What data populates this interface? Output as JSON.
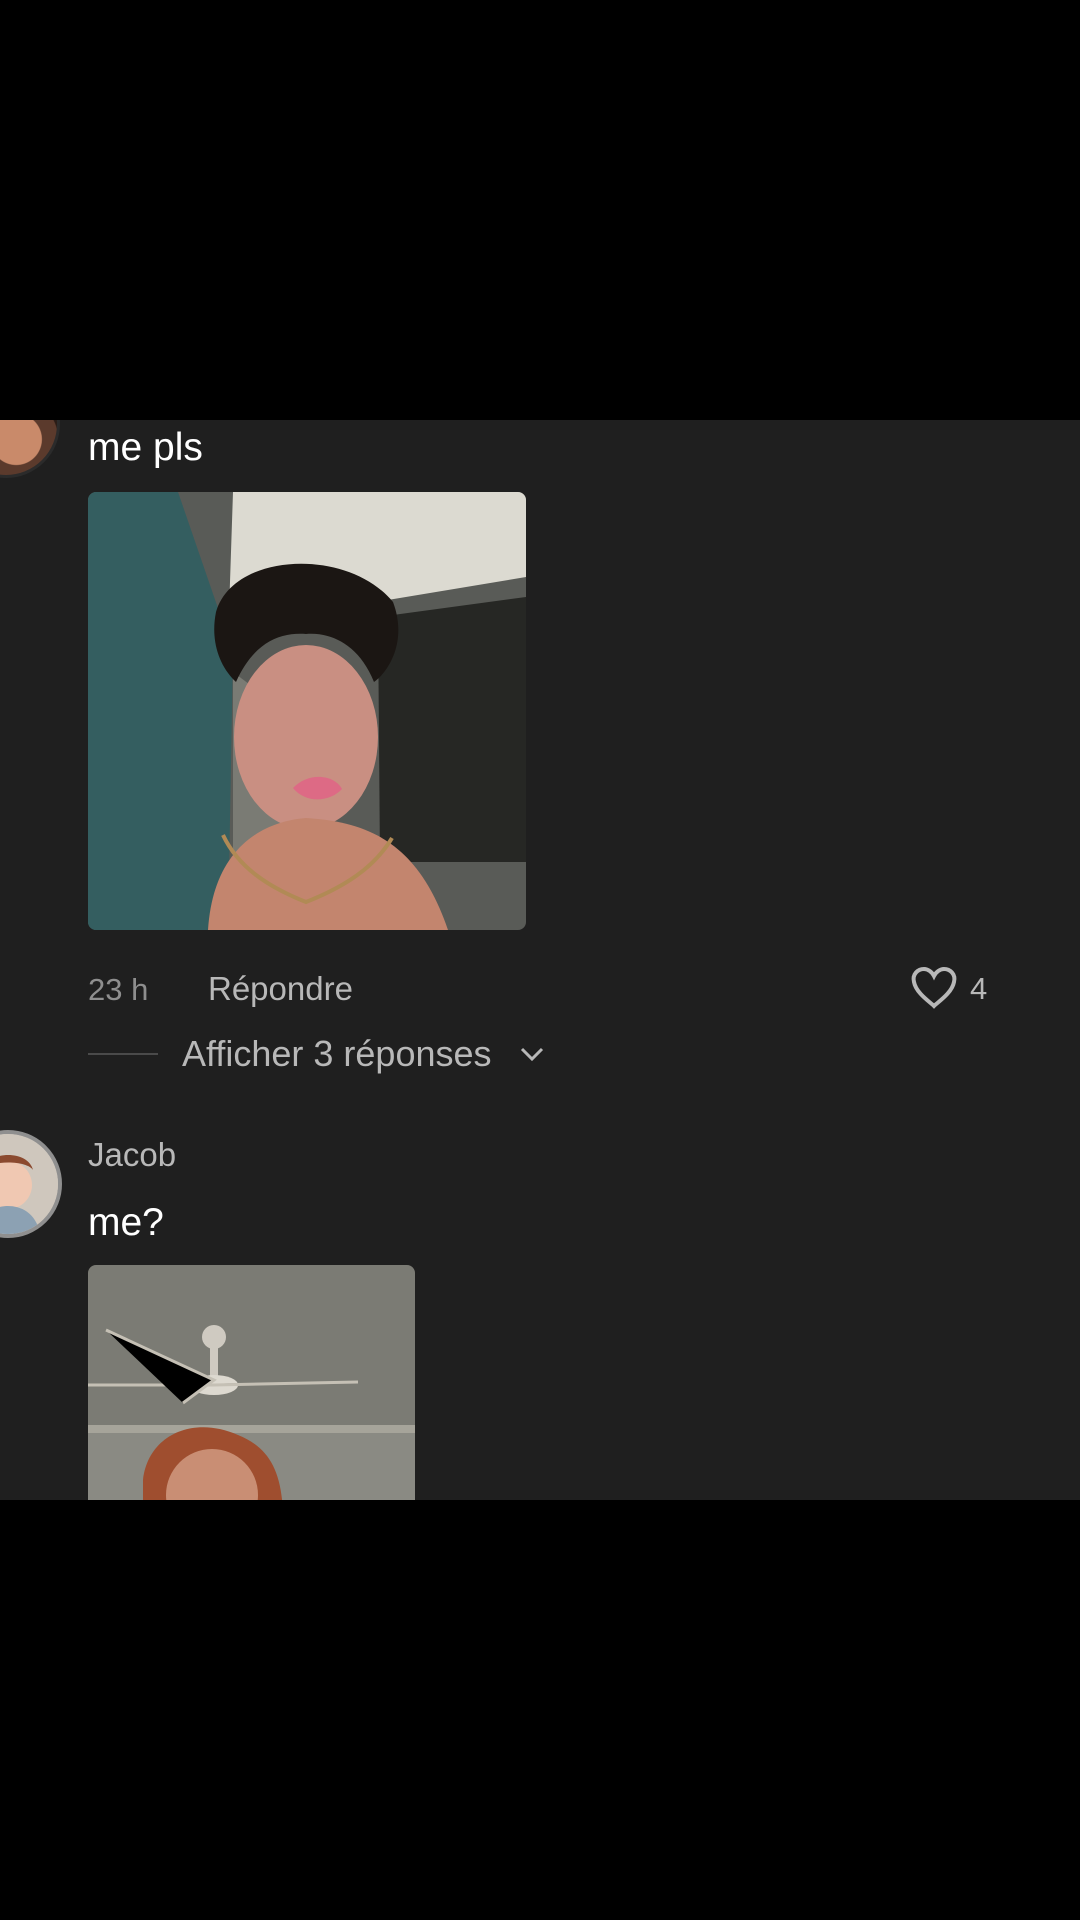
{
  "comments": [
    {
      "username": "",
      "text": "me pls",
      "time": "23 h",
      "reply_label": "Répondre",
      "likes": "4",
      "replies_label": "Afficher 3 réponses"
    },
    {
      "username": "Jacob",
      "text": "me?"
    }
  ],
  "icons": {
    "like": "heart-icon",
    "expand": "chevron-down-icon"
  },
  "colors": {
    "background": "#000000",
    "panel": "#1f1f1f",
    "primary_text": "#ffffff",
    "secondary_text": "#b8b8b8"
  }
}
